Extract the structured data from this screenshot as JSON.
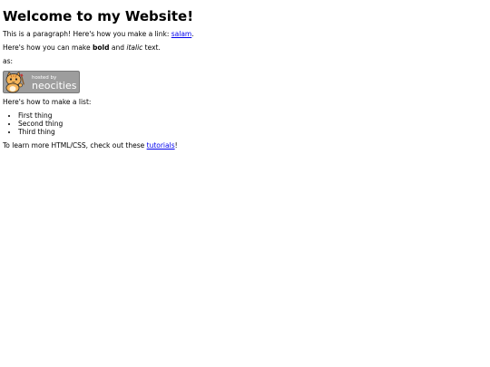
{
  "heading": "Welcome to my Website!",
  "intro": {
    "before": "This is a paragraph! Here's how you make a link: ",
    "link": "salam",
    "after": "."
  },
  "formatting": {
    "before": "Here's how you can make ",
    "bold": "bold",
    "middle": " and ",
    "italic": "italic",
    "after": " text."
  },
  "as_label": "as:",
  "badge": {
    "line1": "hosted by",
    "line2": "neocities"
  },
  "list_intro": "Here's how to make a list:",
  "list_items": [
    "First thing",
    "Second thing",
    "Third thing"
  ],
  "outro": {
    "before": "To learn more HTML/CSS, check out these ",
    "link": "tutorials",
    "after": "!"
  },
  "colors": {
    "link": "#0000ee",
    "badge_bg": "#9d9d9d",
    "cat_orange": "#f0a040"
  }
}
